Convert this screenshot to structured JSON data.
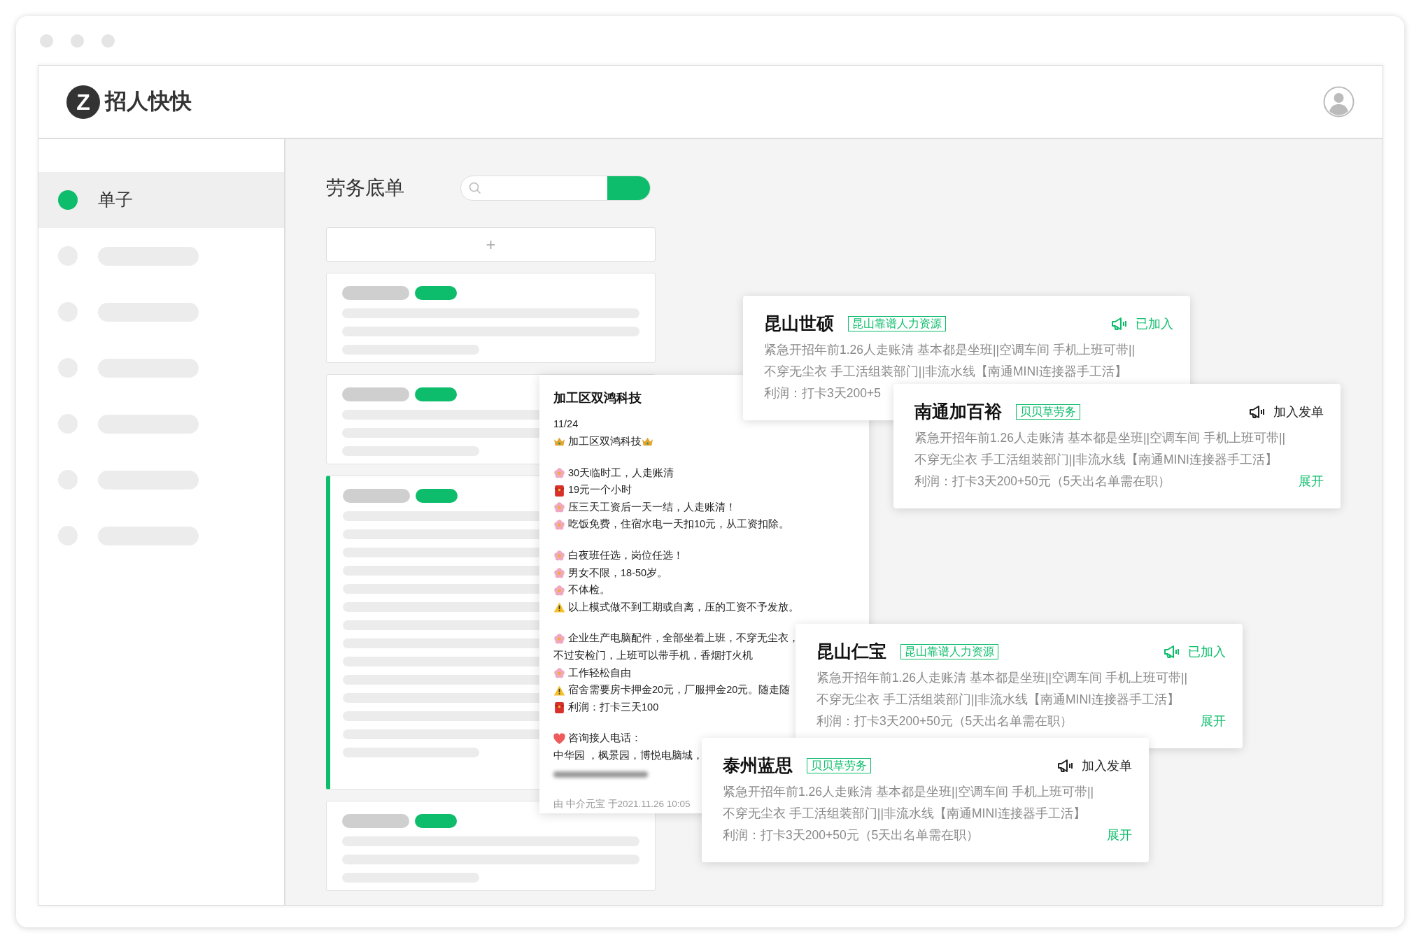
{
  "app": {
    "logo_letter": "Z",
    "title": "招人快快"
  },
  "sidebar": {
    "items": [
      {
        "label": "单子",
        "selected": true
      },
      {
        "selected": false
      },
      {
        "selected": false
      },
      {
        "selected": false
      },
      {
        "selected": false
      },
      {
        "selected": false
      },
      {
        "selected": false
      }
    ]
  },
  "main": {
    "title": "劳务底单",
    "add_button": "+"
  },
  "job_list": [
    {
      "kind": "short",
      "selected": false
    },
    {
      "kind": "short",
      "selected": false
    },
    {
      "kind": "long",
      "selected": true
    },
    {
      "kind": "short",
      "selected": false
    }
  ],
  "message": {
    "title": "加工区双鸿科技",
    "lines": [
      {
        "kind": "plain",
        "text": "11/24"
      },
      {
        "kind": "crowned",
        "text": "加工区双鸿科技"
      },
      {
        "kind": "gap"
      },
      {
        "kind": "flower",
        "text": "30天临时工，人走账清"
      },
      {
        "kind": "envelope",
        "text": "19元一个小时"
      },
      {
        "kind": "flower",
        "text": "压三天工资后一天一结，人走账清！"
      },
      {
        "kind": "flower",
        "text": "吃饭免费，住宿水电一天扣10元，从工资扣除。"
      },
      {
        "kind": "gap"
      },
      {
        "kind": "flower",
        "text": "白夜班任选，岗位任选！"
      },
      {
        "kind": "flower",
        "text": "男女不限，18-50岁。"
      },
      {
        "kind": "flower",
        "text": "不体检。"
      },
      {
        "kind": "warning",
        "text": "以上模式做不到工期或自离，压的工资不予发放。"
      },
      {
        "kind": "gap"
      },
      {
        "kind": "flower",
        "text": "企业生产电脑配件，全部坐着上班，不穿无尘衣，"
      },
      {
        "kind": "plain",
        "text": "不过安检门，上班可以带手机，香烟打火机"
      },
      {
        "kind": "flower",
        "text": "工作轻松自由"
      },
      {
        "kind": "warning",
        "text": "宿舍需要房卡押金20元，厂服押金20元。随走随"
      },
      {
        "kind": "envelope",
        "text": "利润：打卡三天100"
      },
      {
        "kind": "gap"
      },
      {
        "kind": "heart",
        "text": "咨询接人电话："
      },
      {
        "kind": "plain",
        "text": "中华园 ，枫景园，博悦电脑城，"
      },
      {
        "kind": "redacted"
      }
    ],
    "footer": "由 中介元宝 于2021.11.26  10:05"
  },
  "cards": [
    {
      "company": "昆山世硕",
      "agency": "昆山靠谱人力资源",
      "joined": true,
      "status": "已加入",
      "lines": [
        "紧急开招年前1.26人走账清 基本都是坐班||空调车间 手机上班可带||",
        "不穿无尘衣 手工活组装部门||非流水线【南通MINI连接器手工活】"
      ],
      "profit": "利润：打卡3天200+5"
    },
    {
      "company": "南通加百裕",
      "agency": "贝贝草劳务",
      "joined": false,
      "status": "加入发单",
      "lines": [
        "紧急开招年前1.26人走账清 基本都是坐班||空调车间 手机上班可带||",
        "不穿无尘衣 手工活组装部门||非流水线【南通MINI连接器手工活】"
      ],
      "profit": "利润：打卡3天200+50元（5天出名单需在职）",
      "expand": "展开"
    },
    {
      "company": "昆山仁宝",
      "agency": "昆山靠谱人力资源",
      "joined": true,
      "status": "已加入",
      "lines": [
        "紧急开招年前1.26人走账清 基本都是坐班||空调车间 手机上班可带||",
        "不穿无尘衣 手工活组装部门||非流水线【南通MINI连接器手工活】"
      ],
      "profit": "利润：打卡3天200+50元（5天出名单需在职）",
      "expand": "展开"
    },
    {
      "company": "泰州蓝思",
      "agency": "贝贝草劳务",
      "joined": false,
      "status": "加入发单",
      "lines": [
        "紧急开招年前1.26人走账清 基本都是坐班||空调车间 手机上班可带||",
        "不穿无尘衣 手工活组装部门||非流水线【南通MINI连接器手工活】"
      ],
      "profit": "利润：打卡3天200+50元（5天出名单需在职）",
      "expand": "展开"
    }
  ]
}
